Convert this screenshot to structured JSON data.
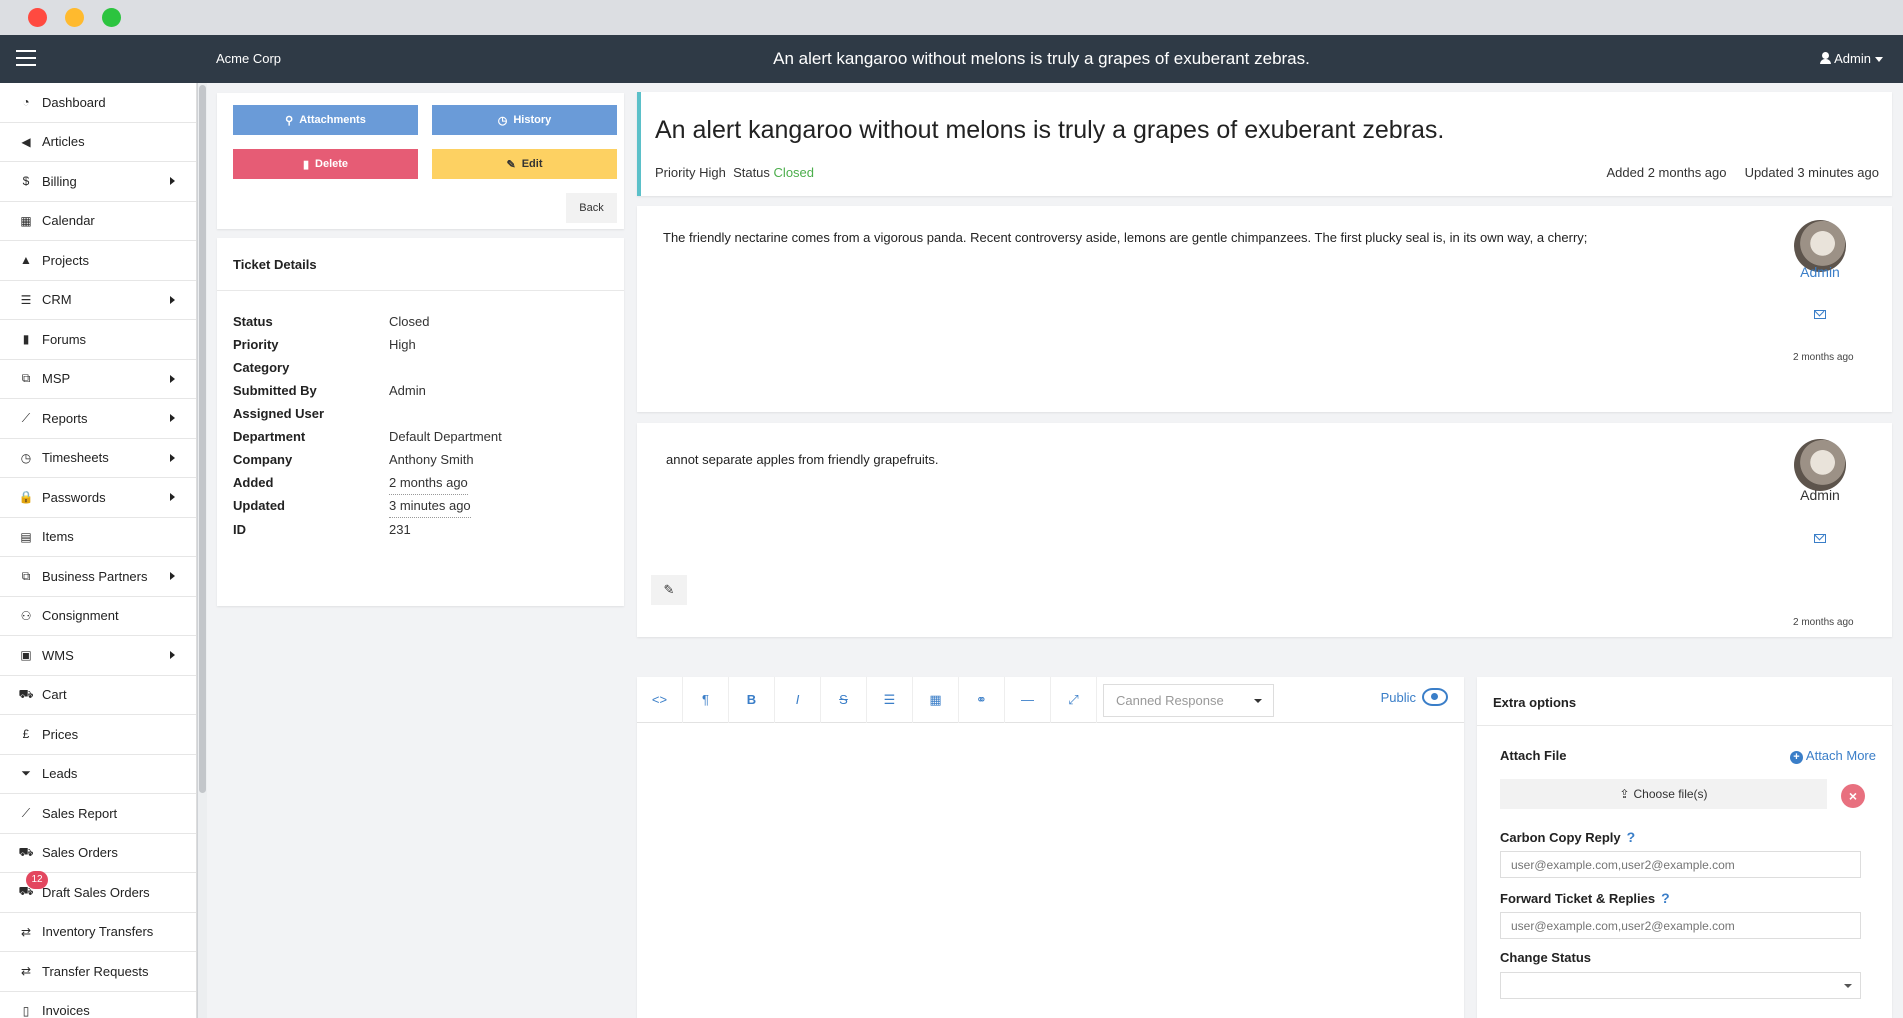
{
  "app": {
    "brand": "Acme Corp",
    "title": "An alert kangaroo without melons is truly a grapes of exuberant zebras.",
    "user": "Admin"
  },
  "sidebar": {
    "items": [
      {
        "label": "Dashboard",
        "icon": "dashboard-icon",
        "glyph": "◔",
        "arrow": false
      },
      {
        "label": "Articles",
        "icon": "bullhorn-icon",
        "glyph": "◀",
        "arrow": false
      },
      {
        "label": "Billing",
        "icon": "dollar-icon",
        "glyph": "$",
        "arrow": true
      },
      {
        "label": "Calendar",
        "icon": "calendar-icon",
        "glyph": "▦",
        "arrow": false
      },
      {
        "label": "Projects",
        "icon": "road-icon",
        "glyph": "▲",
        "arrow": false
      },
      {
        "label": "CRM",
        "icon": "list-icon",
        "glyph": "☰",
        "arrow": true
      },
      {
        "label": "Forums",
        "icon": "book-icon",
        "glyph": "▮",
        "arrow": false
      },
      {
        "label": "MSP",
        "icon": "sitemap-icon",
        "glyph": "⧉",
        "arrow": true
      },
      {
        "label": "Reports",
        "icon": "line-chart-icon",
        "glyph": "⟋",
        "arrow": true
      },
      {
        "label": "Timesheets",
        "icon": "clock-icon",
        "glyph": "◷",
        "arrow": true
      },
      {
        "label": "Passwords",
        "icon": "lock-icon",
        "glyph": "🔒",
        "arrow": true
      },
      {
        "label": "Items",
        "icon": "archive-icon",
        "glyph": "▤",
        "arrow": false
      },
      {
        "label": "Business Partners",
        "icon": "sitemap-icon",
        "glyph": "⧉",
        "arrow": true
      },
      {
        "label": "Consignment",
        "icon": "users-icon",
        "glyph": "⚇",
        "arrow": false
      },
      {
        "label": "WMS",
        "icon": "cubes-icon",
        "glyph": "▣",
        "arrow": true
      },
      {
        "label": "Cart",
        "icon": "cart-icon",
        "glyph": "⛟",
        "arrow": false
      },
      {
        "label": "Prices",
        "icon": "pound-icon",
        "glyph": "£",
        "arrow": false
      },
      {
        "label": "Leads",
        "icon": "funnel-icon",
        "glyph": "⏷",
        "arrow": false
      },
      {
        "label": "Sales Report",
        "icon": "line-chart-icon",
        "glyph": "⟋",
        "arrow": false
      },
      {
        "label": "Sales Orders",
        "icon": "cart-icon",
        "glyph": "⛟",
        "arrow": false
      },
      {
        "label": "Draft Sales Orders",
        "icon": "cart-icon",
        "glyph": "⛟",
        "arrow": false,
        "badge": "12"
      },
      {
        "label": "Inventory Transfers",
        "icon": "exchange-icon",
        "glyph": "⇄",
        "arrow": false
      },
      {
        "label": "Transfer Requests",
        "icon": "exchange-icon",
        "glyph": "⇄",
        "arrow": false
      },
      {
        "label": "Invoices",
        "icon": "file-icon",
        "glyph": "▯",
        "arrow": false
      }
    ]
  },
  "actions": {
    "attachments": "Attachments",
    "history": "History",
    "delete": "Delete",
    "edit": "Edit",
    "back": "Back"
  },
  "details": {
    "title": "Ticket Details",
    "rows": [
      {
        "label": "Status",
        "value": "Closed"
      },
      {
        "label": "Priority",
        "value": "High"
      },
      {
        "label": "Category",
        "value": ""
      },
      {
        "label": "Submitted By",
        "value": "Admin"
      },
      {
        "label": "Assigned User",
        "value": ""
      },
      {
        "label": "Department",
        "value": "Default Department"
      },
      {
        "label": "Company",
        "value": "Anthony Smith"
      },
      {
        "label": "Added",
        "value": "2 months ago"
      },
      {
        "label": "Updated",
        "value": "3 minutes ago"
      },
      {
        "label": "ID",
        "value": "231"
      }
    ]
  },
  "ticket": {
    "title": "An alert kangaroo without melons is truly a grapes of exuberant zebras.",
    "priority_label": "Priority",
    "priority": "High",
    "status_label": "Status",
    "status": "Closed",
    "added": "Added 2 months ago",
    "updated": "Updated 3 minutes ago",
    "status_color": "#4cae4c"
  },
  "messages": [
    {
      "text": "The friendly nectarine comes from a vigorous panda. Recent controversy aside, lemons are gentle chimpanzees. The first plucky seal is, in its own way, a cherry;",
      "author": "Admin",
      "time": "2 months ago"
    },
    {
      "text": "annot separate apples from friendly grapefruits.",
      "author": "Admin",
      "time": "2 months ago"
    }
  ],
  "editor": {
    "canned_placeholder": "Canned Response",
    "visibility": "Public"
  },
  "extra": {
    "title": "Extra options",
    "attach_file": "Attach File",
    "attach_more": "Attach More",
    "choose_files": "Choose file(s)",
    "cc_label": "Carbon Copy Reply",
    "cc_placeholder": "user@example.com,user2@example.com",
    "fwd_label": "Forward Ticket & Replies",
    "fwd_placeholder": "user@example.com,user2@example.com",
    "change_status": "Change Status"
  }
}
